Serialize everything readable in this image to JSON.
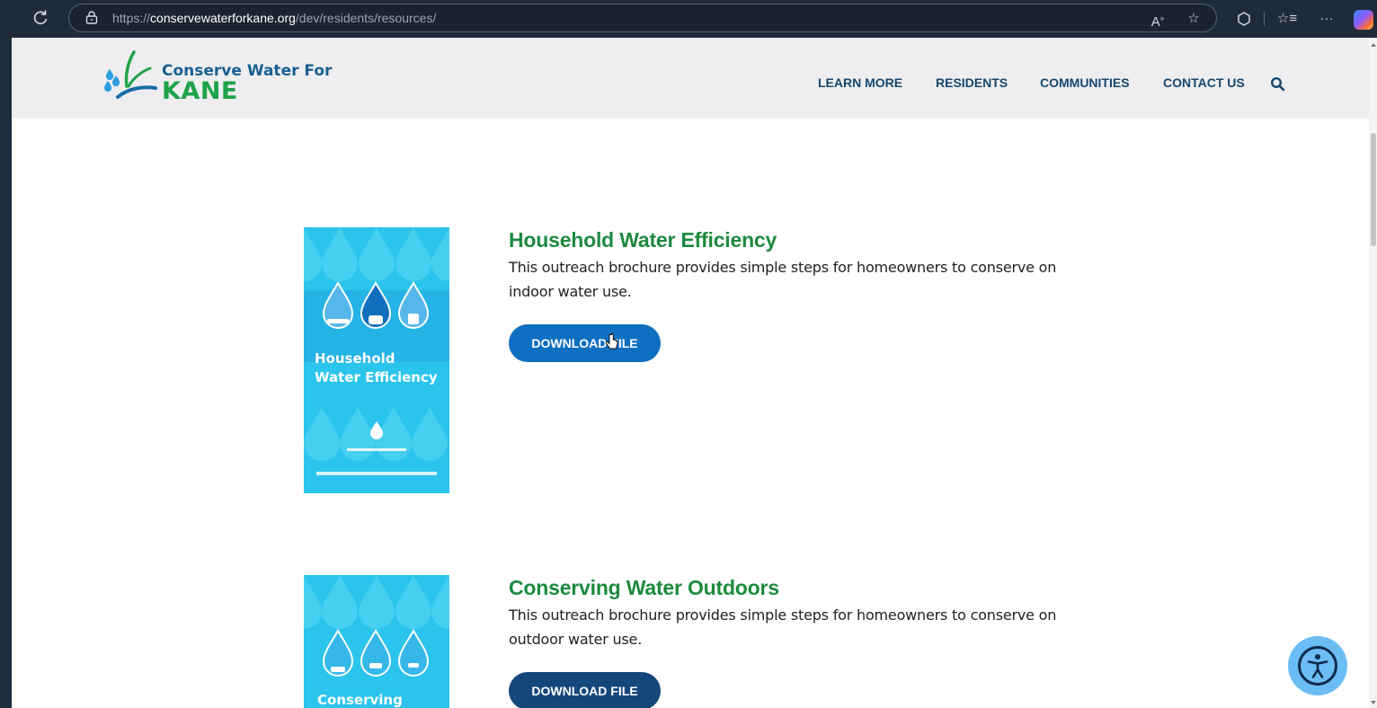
{
  "browser": {
    "url_prefix": "https://",
    "url_domain": "conservewaterforkane.org",
    "url_path": "/dev/residents/resources/"
  },
  "site": {
    "logo_line1": "Conserve Water For",
    "logo_line2": "KANE",
    "nav": [
      "LEARN MORE",
      "RESIDENTS",
      "COMMUNITIES",
      "CONTACT US"
    ]
  },
  "resources": [
    {
      "title": "Household Water Efficiency",
      "description": "This outreach brochure provides simple steps for homeowners to conserve on indoor water use.",
      "button": "DOWNLOAD FILE",
      "cover_line1": "Household",
      "cover_line2": "Water Efficiency"
    },
    {
      "title": "Conserving Water Outdoors",
      "description": "This outreach brochure provides simple steps for homeowners to conserve on outdoor water use.",
      "button": "DOWNLOAD FILE",
      "cover_line1": "Conserving"
    }
  ],
  "colors": {
    "title_green": "#1d8a3f",
    "nav_blue": "#17466e",
    "button_blue": "#0d6fbf",
    "button_dark": "#15477c",
    "cover_cyan": "#2bc4ec"
  },
  "icons": {
    "reload": "reload-icon",
    "lock": "lock-icon",
    "read_aloud": "read-aloud-icon",
    "favorite": "star-icon",
    "extensions": "extensions-icon",
    "favorites": "favorites-icon",
    "more": "more-icon",
    "search": "search-icon",
    "accessibility": "accessibility-icon"
  }
}
